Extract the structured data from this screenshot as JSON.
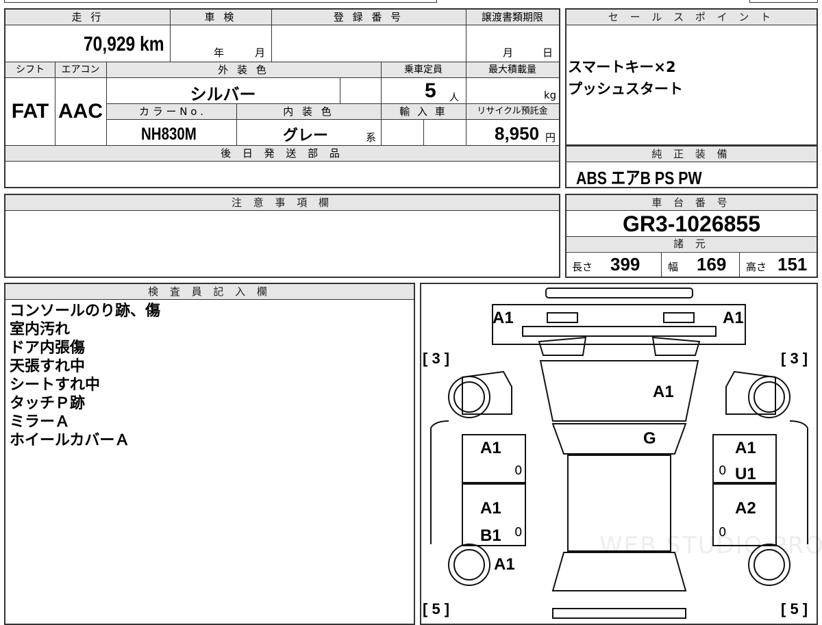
{
  "top_table": {
    "h_mileage": "走 行",
    "h_inspection": "車 検",
    "h_registration": "登 録 番 号",
    "h_transfer": "譲渡書類期限",
    "mileage": "70,929 km",
    "inspection_year": "年",
    "inspection_month": "月",
    "transfer_month": "月",
    "transfer_day": "日",
    "h_shift": "シフト",
    "h_aircon": "エアコン",
    "h_exterior": "外 装 色",
    "h_capacity": "乗車定員",
    "h_maxload": "最大積載量",
    "shift": "FAT",
    "aircon": "AAC",
    "exterior_color": "シルバー",
    "capacity": "5",
    "capacity_unit": "人",
    "maxload_unit": "kg",
    "h_color_no": "カ ラ ー N o .",
    "h_interior": "内 装 色",
    "h_import": "輸 入 車",
    "h_recycle": "リサイクル預託金",
    "color_no": "NH830M",
    "interior_color": "グレー",
    "interior_suffix": "系",
    "recycle_fee": "8,950",
    "recycle_unit": "円",
    "h_later_parts": "後 日 発 送 部 品"
  },
  "sales_point": {
    "header": "セ ー ル ス ポ イ ン ト",
    "lines": [
      "スマートキー×2",
      "プッシュスタート"
    ]
  },
  "genuine_equipment": {
    "header": "純 正 装 備",
    "value": "ABS エアB PS PW"
  },
  "notes": {
    "header": "注 意 事 項 欄"
  },
  "chassis": {
    "header": "車 台 番 号",
    "number": "GR3-1026855"
  },
  "specs": {
    "header": "諸 元",
    "length_label": "長さ",
    "length": "399",
    "width_label": "幅",
    "width": "169",
    "height_label": "高さ",
    "height": "151"
  },
  "inspector": {
    "header": "検 査 員 記 入 欄",
    "lines": [
      "コンソールのり跡、傷",
      "室内汚れ",
      "ドア内張傷",
      "天張すれ中",
      "シートすれ中",
      "タッチＰ跡",
      "ミラーＡ",
      "ホイールカバーＡ"
    ]
  },
  "diagram": {
    "front_left": "A1",
    "front_right": "A1",
    "tire_fl": "[ 3 ]",
    "tire_fr": "[ 3 ]",
    "tire_rl": "[ 5 ]",
    "tire_rr": "[ 5 ]",
    "hood": "A1",
    "windshield": "G",
    "front_door_left": "A1",
    "front_door_right_1": "A1",
    "front_door_right_2": "U1",
    "rear_door_left_1": "A1",
    "rear_door_left_2": "B1",
    "rear_door_right": "A2",
    "rear_quarter_left": "A1",
    "zero_1": "0",
    "zero_2": "0",
    "zero_3": "0",
    "zero_4": "0",
    "watermark": "WEB STUDIO PRO"
  }
}
